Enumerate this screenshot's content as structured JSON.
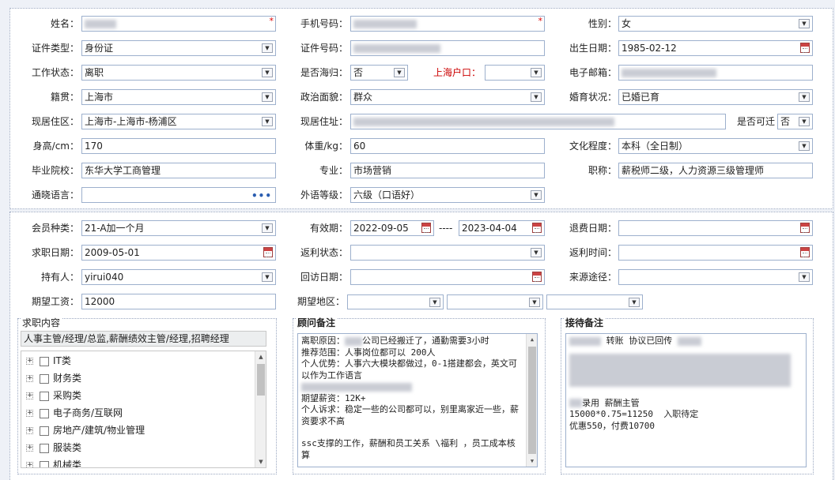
{
  "basic": {
    "name": {
      "label": "姓名："
    },
    "phone": {
      "label": "手机号码："
    },
    "gender": {
      "label": "性别：",
      "value": "女"
    },
    "idtype": {
      "label": "证件类型：",
      "value": "身份证"
    },
    "idno": {
      "label": "证件号码："
    },
    "birth": {
      "label": "出生日期：",
      "value": "1985-02-12"
    },
    "workstatus": {
      "label": "工作状态：",
      "value": "离职"
    },
    "returnee": {
      "label": "是否海归：",
      "value": "否"
    },
    "hukou": {
      "label": "上海户口："
    },
    "email": {
      "label": "电子邮箱："
    },
    "origin": {
      "label": "籍贯：",
      "value": "上海市"
    },
    "political": {
      "label": "政治面貌：",
      "value": "群众"
    },
    "marital": {
      "label": "婚育状况：",
      "value": "已婚已育"
    },
    "area": {
      "label": "现居住区：",
      "value": "上海市-上海市-杨浦区"
    },
    "address": {
      "label": "现居住址："
    },
    "relocate": {
      "label": "是否可迁",
      "value": "否"
    },
    "height": {
      "label": "身高/cm：",
      "value": "170"
    },
    "weight": {
      "label": "体重/kg：",
      "value": "60"
    },
    "education": {
      "label": "文化程度：",
      "value": "本科（全日制）"
    },
    "school": {
      "label": "毕业院校：",
      "value": "东华大学工商管理"
    },
    "major": {
      "label": "专业：",
      "value": "市场营销"
    },
    "title": {
      "label": "职称：",
      "value": "薪税师二级，人力资源三级管理师"
    },
    "languages": {
      "label": "通晓语言："
    },
    "langlevel": {
      "label": "外语等级：",
      "value": "六级（口语好）"
    }
  },
  "membership": {
    "type": {
      "label": "会员种类：",
      "value": "21-A加一个月"
    },
    "validity": {
      "label": "有效期：",
      "from": "2022-09-05",
      "sep": "----",
      "to": "2023-04-04"
    },
    "refund_date": {
      "label": "退费日期："
    },
    "job_date": {
      "label": "求职日期：",
      "value": "2009-05-01"
    },
    "rebate_status": {
      "label": "返利状态："
    },
    "rebate_time": {
      "label": "返利时间："
    },
    "holder": {
      "label": "持有人：",
      "value": "yirui040"
    },
    "visit_date": {
      "label": "回访日期："
    },
    "source": {
      "label": "来源途径："
    },
    "salary": {
      "label": "期望工资：",
      "value": "12000"
    },
    "region": {
      "label": "期望地区："
    }
  },
  "job_content": {
    "title": "求职内容",
    "selected": "人事主管/经理/总监,薪酬绩效主管/经理,招聘经理",
    "tree": [
      "IT类",
      "财务类",
      "采购类",
      "电子商务/互联网",
      "房地产/建筑/物业管理",
      "服装类",
      "机械类"
    ]
  },
  "consultant_notes": {
    "title": "顾问备注",
    "lines": [
      "离职原因：[blur]公司已经搬迁了，通勤需要3小时",
      "推荐范围：人事岗位都可以 200人",
      "个人优势：人事六大模块都做过，0-1搭建都会，英文可以作为工作语言",
      "[blur]",
      "期望薪资：12K+",
      "个人诉求：稳定一些的公司都可以，别里离家近一些，薪资要求不高",
      "",
      "ssc支撑的工作，薪酬和员工关系 \\福利 ，员工成本核算"
    ]
  },
  "reception_notes": {
    "title": "接待备注",
    "line1": "转账 协议已回传",
    "line_hired": "录用 薪酬主管",
    "line_calc": "15000*0.75=11250  入职待定",
    "line_discount": "优惠550，付费10700"
  },
  "icons": {
    "dropdown": "chevron-down-icon",
    "calendar": "calendar-icon",
    "ellipsis": "ellipsis-icon",
    "required": "asterisk-icon"
  }
}
